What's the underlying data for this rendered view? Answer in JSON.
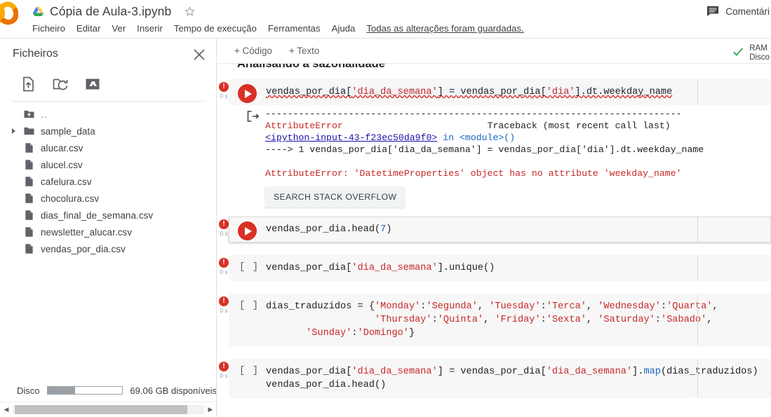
{
  "topbar": {
    "logo": "colab-logo",
    "drive_icon": "drive-icon",
    "title": "Cópia de Aula-3.ipynb",
    "star_icon": "star-icon",
    "menu": [
      "Ficheiro",
      "Editar",
      "Ver",
      "Inserir",
      "Tempo de execução",
      "Ferramentas",
      "Ajuda"
    ],
    "saved_note": "Todas as alterações foram guardadas.",
    "comment_icon": "comment-icon",
    "comment_label": "Comentári"
  },
  "sidebar": {
    "title": "Ficheiros",
    "close_icon": "close-icon",
    "tools": [
      {
        "icon": "upload-file-icon",
        "name": "upload-to-session-storage"
      },
      {
        "icon": "refresh-folder-icon",
        "name": "refresh-folder"
      },
      {
        "icon": "mount-drive-icon",
        "name": "mount-google-drive"
      }
    ],
    "files": [
      {
        "name": "..",
        "type": "parent",
        "twisty": false
      },
      {
        "name": "sample_data",
        "type": "folder",
        "twisty": true
      },
      {
        "name": "alucar.csv",
        "type": "file",
        "twisty": false
      },
      {
        "name": "alucel.csv",
        "type": "file",
        "twisty": false
      },
      {
        "name": "cafelura.csv",
        "type": "file",
        "twisty": false
      },
      {
        "name": "chocolura.csv",
        "type": "file",
        "twisty": false
      },
      {
        "name": "dias_final_de_semana.csv",
        "type": "file",
        "twisty": false
      },
      {
        "name": "newsletter_alucar.csv",
        "type": "file",
        "twisty": false
      },
      {
        "name": "vendas_por_dia.csv",
        "type": "file",
        "twisty": false
      }
    ],
    "disk": {
      "label": "Disco",
      "free": "69.06 GB disponíveis",
      "used_percent": 37
    },
    "scroll": {
      "left_arrow": "◀",
      "right_arrow": "▶"
    }
  },
  "notebook": {
    "toolbar": {
      "add_code": "+ Código",
      "add_text": "+ Texto",
      "check_icon": "check-icon",
      "ram_label": "RAM",
      "disk_label": "Disco"
    },
    "heading": "Analisando a sazonalidade",
    "cells": [
      {
        "id": "cell-1",
        "status": "error",
        "error_time": "0 s",
        "prompt": "run",
        "selected": false,
        "code_plain": "vendas_por_dia['dia_da_semana'] = vendas_por_dia['dia'].dt.weekday_name",
        "output": {
          "dashes": "---------------------------------------------------------------------------",
          "error_type": "AttributeError",
          "traceback_header": "Traceback (most recent call last)",
          "input_ref": "<ipython-input-43-f23ec50da9f0>",
          "in_module": "in <module>()",
          "arrow_line": "----> 1 vendas_por_dia['dia_da_semana'] = vendas_por_dia['dia'].dt.weekday_name",
          "message": "AttributeError: 'DatetimeProperties' object has no attribute 'weekday_name'",
          "so_button": "SEARCH STACK OVERFLOW"
        }
      },
      {
        "id": "cell-2",
        "status": "error",
        "error_time": "0 s",
        "prompt": "run",
        "selected": true,
        "code_plain": "vendas_por_dia.head(7)"
      },
      {
        "id": "cell-3",
        "status": "error",
        "error_time": "0 s",
        "prompt": "[ ]",
        "selected": false,
        "code_plain": "vendas_por_dia['dia_da_semana'].unique()"
      },
      {
        "id": "cell-4",
        "status": "error",
        "error_time": "0 s",
        "prompt": "[ ]",
        "selected": false,
        "code_plain": "dias_traduzidos = {'Monday':'Segunda', 'Tuesday':'Terca', 'Wednesday':'Quarta',\n                   'Thursday':'Quinta', 'Friday':'Sexta', 'Saturday':'Sabado',\n       'Sunday':'Domingo'}"
      },
      {
        "id": "cell-5",
        "status": "error",
        "error_time": "0 s",
        "prompt": "[ ]",
        "selected": false,
        "code_plain": "vendas_por_dia['dia_da_semana'] = vendas_por_dia['dia_da_semana'].map(dias_traduzidos)\nvendas_por_dia.head()"
      }
    ]
  }
}
